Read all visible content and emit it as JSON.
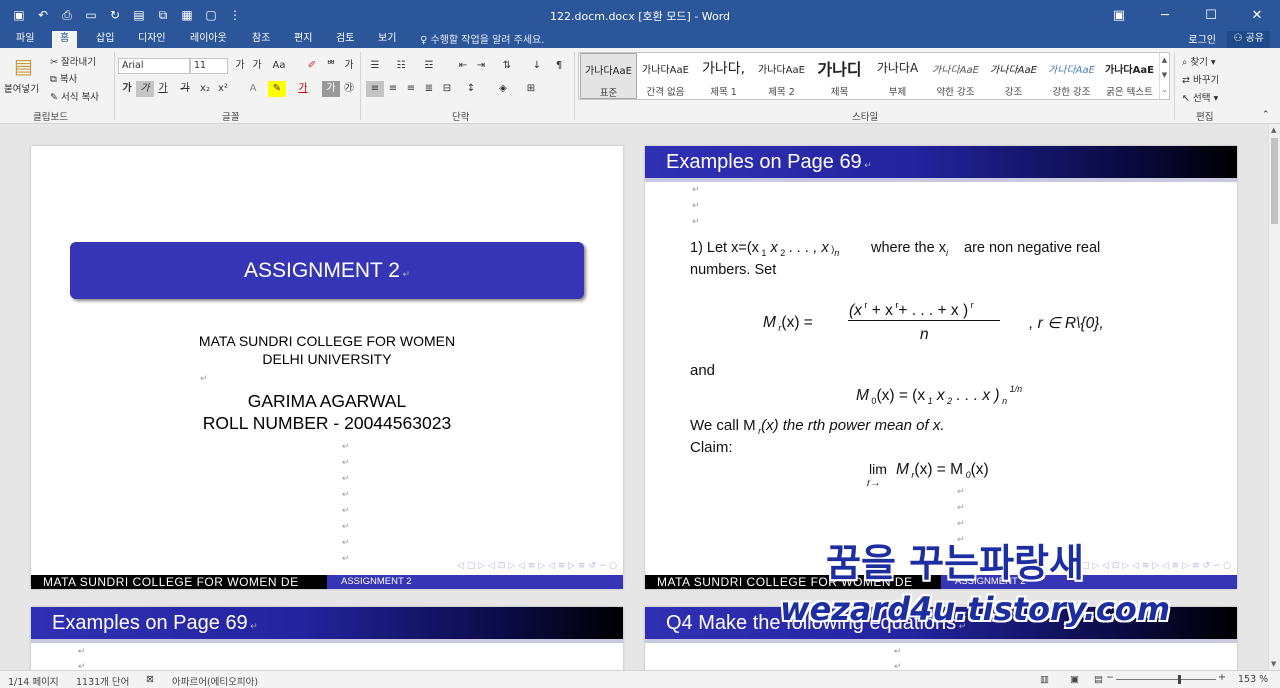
{
  "window": {
    "title": "122.docm.docx [호환 모드] - Word",
    "controls": [
      "restore-icon",
      "minimize-icon",
      "maximize-icon",
      "close-icon"
    ]
  },
  "qat": [
    "save-icon",
    "undo-icon",
    "print-preview-icon",
    "toggle-icon",
    "redo-icon",
    "open-icon",
    "copy-icon",
    "doc-icon",
    "new-icon",
    "customize-icon"
  ],
  "tabs": [
    "파일",
    "홈",
    "삽입",
    "디자인",
    "레이아웃",
    "참조",
    "편지",
    "검토",
    "보기"
  ],
  "active_tab": "홈",
  "tell_me": "수행할 작업을 알려 주세요.",
  "account": {
    "login": "로그인",
    "share": "공유"
  },
  "ribbon": {
    "clipboard": {
      "paste": "붙여넣기",
      "cut": "잘라내기",
      "copy": "복사",
      "format_painter": "서식 복사",
      "label": "클립보드"
    },
    "font": {
      "name": "Arial",
      "size": "11",
      "label": "글꼴"
    },
    "paragraph": {
      "label": "단락"
    },
    "styles": {
      "label": "스타일",
      "items": [
        {
          "sample": "가나다AaE",
          "name": "표준"
        },
        {
          "sample": "가나다AaE",
          "name": "간격 없음"
        },
        {
          "sample": "가나다,",
          "name": "제목 1"
        },
        {
          "sample": "가나다AaE",
          "name": "제목 2"
        },
        {
          "sample": "가나디",
          "name": "제목"
        },
        {
          "sample": "가나다A",
          "name": "부제"
        },
        {
          "sample": "가나다AaE",
          "name": "약한 강조"
        },
        {
          "sample": "가나다AaE",
          "name": "강조"
        },
        {
          "sample": "가나다AaE",
          "name": "강한 강조"
        },
        {
          "sample": "가나다AaE",
          "name": "굵은 텍스트"
        }
      ]
    },
    "editing": {
      "find": "찾기",
      "replace": "바꾸기",
      "select": "선택",
      "label": "편집"
    }
  },
  "pages": {
    "p1": {
      "title": "ASSIGNMENT 2",
      "college": "MATA SUNDRI COLLEGE FOR WOMEN",
      "university": "DELHI UNIVERSITY",
      "name": "GARIMA AGARWAL",
      "roll": "ROLL NUMBER - 20044563023",
      "footer_left": "MATA SUNDRI COLLEGE FOR WOMEN DE",
      "footer_right": "ASSIGNMENT 2"
    },
    "p2": {
      "header": "Examples on Page 69",
      "line1": "1) Let x=(x",
      "line1b": "where the x",
      "line1c": "are non negative real",
      "line2": "numbers. Set",
      "formula_lhs": "M",
      "formula_num": "(x",
      "formula_den": "n",
      "formula_rhs": ", r ∈ R\\{0},",
      "and": "and",
      "m0": "M",
      "m0_rhs": "(x) = (x",
      "we_call": "We call M",
      "we_call_rest": "(x) the rth power mean of x.",
      "claim": "Claim:",
      "lim": "lim",
      "lim_sub": "r→",
      "lim_rhs": "M",
      "footer_left": "MATA SUNDRI COLLEGE FOR WOMEN DE",
      "footer_right": "ASSIGNMENT 2"
    },
    "p3": {
      "header": "Examples on Page 69"
    },
    "p4": {
      "header": "Q4 Make the following equations"
    }
  },
  "status": {
    "page": "1/14 페이지",
    "words": "1131개 단어",
    "language": "아파르어(에티오피아)",
    "zoom": "153 %"
  },
  "watermark": {
    "line1": "꿈을 꾸는파랑새",
    "line2": "wezard4u.tistory.com"
  }
}
